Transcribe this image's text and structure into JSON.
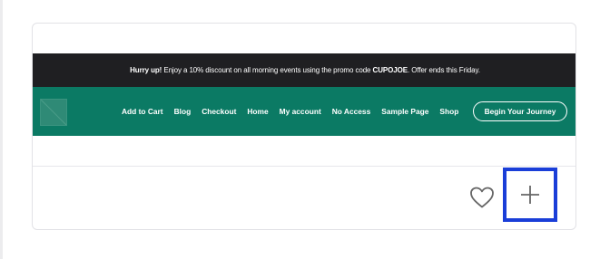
{
  "promo": {
    "lead": "Hurry up!",
    "text_before_code": "Enjoy a 10% discount on all morning events using the promo code",
    "code": "CUPOJOE",
    "text_after_code": ". Offer ends this Friday."
  },
  "nav": {
    "logo_icon": "logo-placeholder-icon",
    "items": [
      {
        "label": "Add to Cart"
      },
      {
        "label": "Blog"
      },
      {
        "label": "Checkout"
      },
      {
        "label": "Home"
      },
      {
        "label": "My account"
      },
      {
        "label": "No Access"
      },
      {
        "label": "Sample Page"
      },
      {
        "label": "Shop"
      }
    ],
    "cta_label": "Begin Your Journey"
  },
  "actions": {
    "favorite_icon": "heart-icon",
    "add_icon": "plus-icon"
  },
  "colors": {
    "promo_bg": "#1f1f22",
    "nav_bg": "#0b7a64",
    "highlight": "#1a3ed8"
  }
}
